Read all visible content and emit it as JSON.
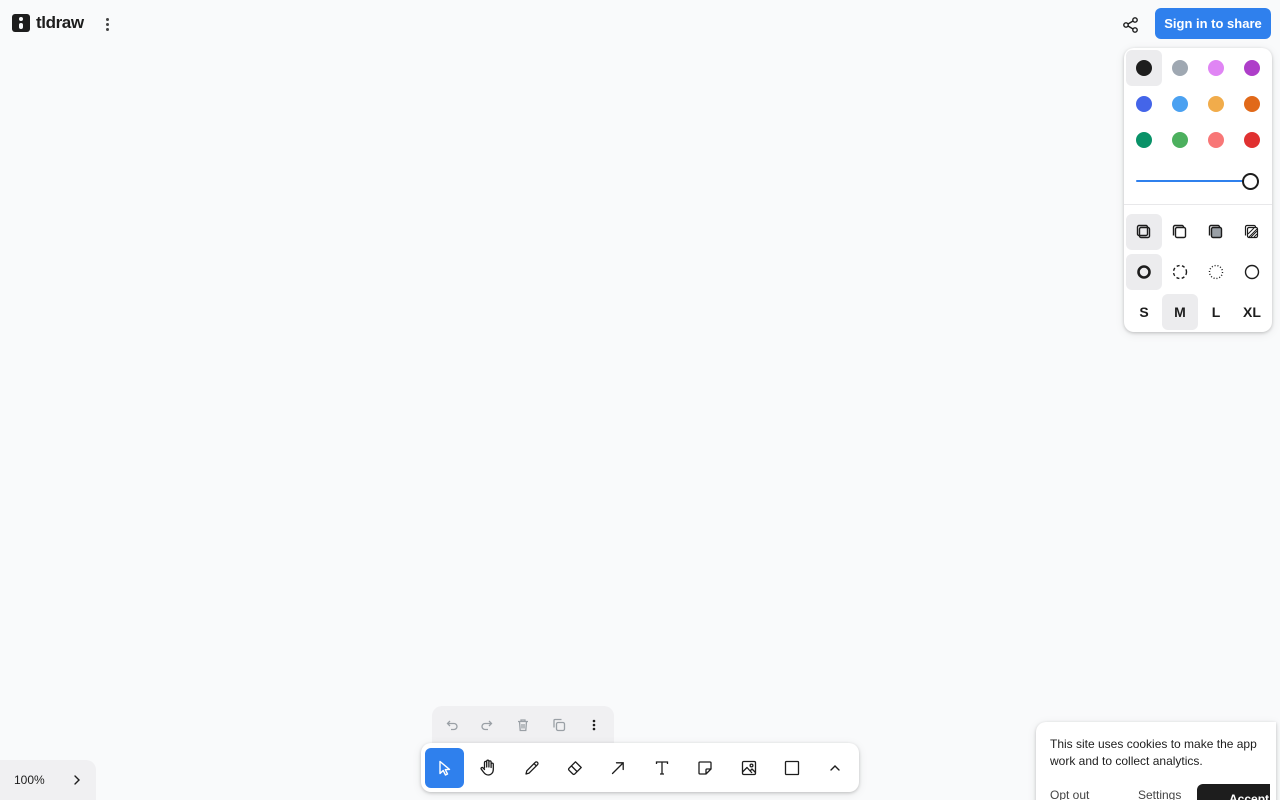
{
  "app": {
    "name": "tldraw"
  },
  "header": {
    "signin_label": "Sign in to share"
  },
  "style_panel": {
    "colors": [
      {
        "name": "black",
        "hex": "#1d1d1d",
        "selected": true
      },
      {
        "name": "grey",
        "hex": "#9fa8b2",
        "selected": false
      },
      {
        "name": "light-violet",
        "hex": "#e085f4",
        "selected": false
      },
      {
        "name": "violet",
        "hex": "#ae3ec9",
        "selected": false
      },
      {
        "name": "blue",
        "hex": "#4465e9",
        "selected": false
      },
      {
        "name": "light-blue",
        "hex": "#4ba1f1",
        "selected": false
      },
      {
        "name": "yellow",
        "hex": "#f1ac4b",
        "selected": false
      },
      {
        "name": "orange",
        "hex": "#e16919",
        "selected": false
      },
      {
        "name": "green",
        "hex": "#099268",
        "selected": false
      },
      {
        "name": "light-green",
        "hex": "#4cb05e",
        "selected": false
      },
      {
        "name": "light-red",
        "hex": "#f87777",
        "selected": false
      },
      {
        "name": "red",
        "hex": "#e03131",
        "selected": false
      }
    ],
    "opacity": 1.0,
    "fill_options": [
      {
        "name": "fill-none-icon",
        "selected": true
      },
      {
        "name": "fill-semi-icon",
        "selected": false
      },
      {
        "name": "fill-solid-icon",
        "selected": false
      },
      {
        "name": "fill-pattern-icon",
        "selected": false
      }
    ],
    "dash_options": [
      {
        "name": "dash-draw-icon",
        "selected": true
      },
      {
        "name": "dash-dashed-icon",
        "selected": false
      },
      {
        "name": "dash-dotted-icon",
        "selected": false
      },
      {
        "name": "dash-solid-icon",
        "selected": false
      }
    ],
    "sizes": [
      {
        "label": "S",
        "selected": false
      },
      {
        "label": "M",
        "selected": true
      },
      {
        "label": "L",
        "selected": false
      },
      {
        "label": "XL",
        "selected": false
      }
    ]
  },
  "actions": [
    "undo-icon",
    "redo-icon",
    "trash-icon",
    "duplicate-icon",
    "more-icon"
  ],
  "tools": [
    {
      "name": "select-tool",
      "icon": "cursor-icon",
      "active": true
    },
    {
      "name": "hand-tool",
      "icon": "hand-icon",
      "active": false
    },
    {
      "name": "draw-tool",
      "icon": "pencil-icon",
      "active": false
    },
    {
      "name": "eraser-tool",
      "icon": "eraser-icon",
      "active": false
    },
    {
      "name": "arrow-tool",
      "icon": "arrow-icon",
      "active": false
    },
    {
      "name": "text-tool",
      "icon": "text-icon",
      "active": false
    },
    {
      "name": "note-tool",
      "icon": "sticky-note-icon",
      "active": false
    },
    {
      "name": "media-tool",
      "icon": "image-icon",
      "active": false
    },
    {
      "name": "rectangle-tool",
      "icon": "rectangle-icon",
      "active": false
    },
    {
      "name": "more-tools",
      "icon": "chevron-up-icon",
      "active": false
    }
  ],
  "zoom": {
    "label": "100%"
  },
  "cookie": {
    "message": "This site uses cookies to make the app work and to collect analytics.",
    "opt_out": "Opt out",
    "settings": "Settings",
    "accept": "Accept"
  }
}
